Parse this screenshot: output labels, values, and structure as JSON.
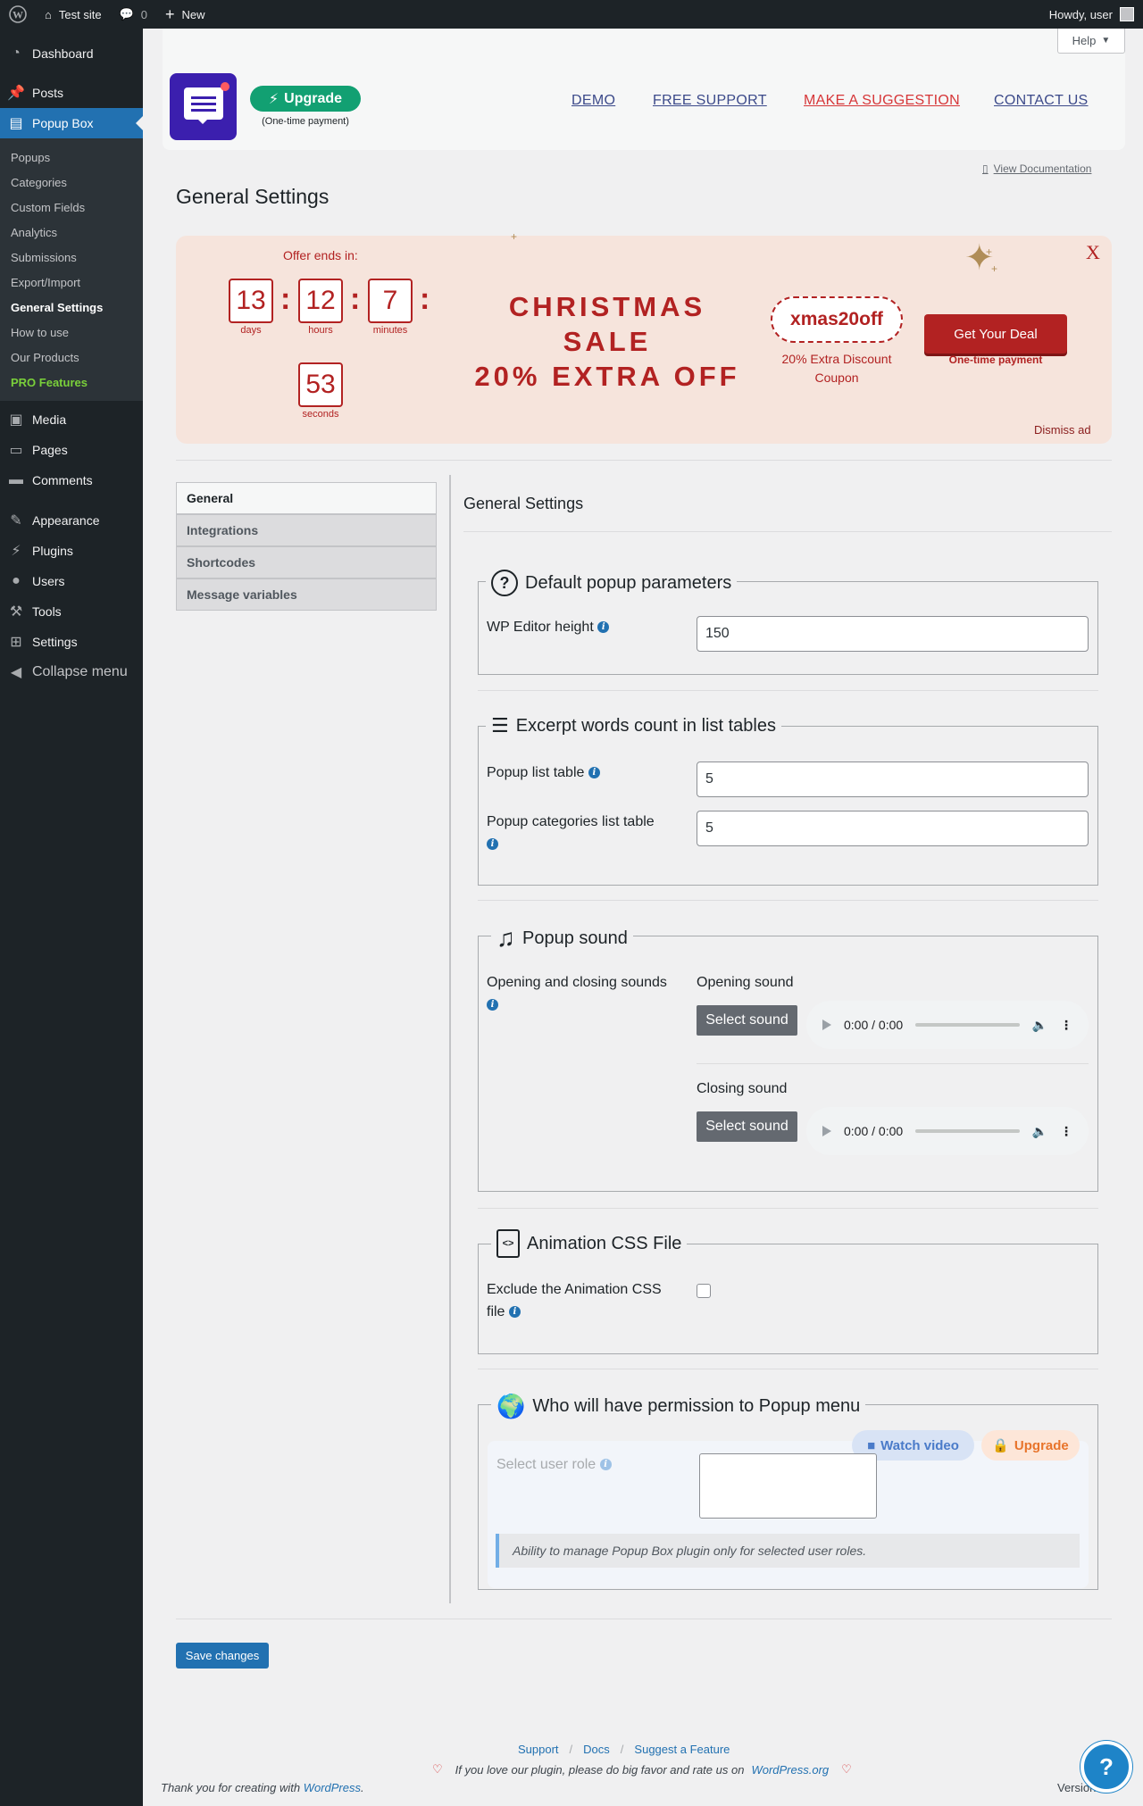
{
  "adminbar": {
    "site_name": "Test site",
    "comments_count": "0",
    "new_label": "New",
    "howdy": "Howdy, user"
  },
  "sidebar": {
    "top_items": [
      {
        "label": "Dashboard",
        "icon": "dashboard-icon"
      },
      {
        "label": "Posts",
        "icon": "pin-icon"
      },
      {
        "label": "Popup Box",
        "icon": "popup-icon"
      }
    ],
    "submenu": [
      "Popups",
      "Categories",
      "Custom Fields",
      "Analytics",
      "Submissions",
      "Export/Import",
      "General Settings",
      "How to use",
      "Our Products",
      "PRO Features"
    ],
    "bottom_items": [
      "Media",
      "Pages",
      "Comments",
      "Appearance",
      "Plugins",
      "Users",
      "Tools",
      "Settings",
      "Collapse menu"
    ]
  },
  "header": {
    "help_label": "Help",
    "upgrade_label": "Upgrade",
    "upgrade_sub": "(One-time payment)",
    "nav": [
      "DEMO",
      "FREE SUPPORT",
      "MAKE A SUGGESTION",
      "CONTACT US"
    ]
  },
  "view_documentation": "View Documentation",
  "page_title": "General Settings",
  "promo": {
    "offer_ends": "Offer ends in:",
    "countdown": {
      "days": "13",
      "days_label": "days",
      "hours": "12",
      "hours_label": "hours",
      "minutes": "7",
      "minutes_label": "minutes",
      "seconds": "53",
      "seconds_label": "seconds"
    },
    "title_line1": "CHRISTMAS",
    "title_line2": "SALE",
    "title_line3": "20% EXTRA OFF",
    "coupon_code": "xmas20off",
    "coupon_note": "20% Extra Discount Coupon",
    "deal_button": "Get Your Deal",
    "deal_note": "One-time payment",
    "close": "X",
    "dismiss": "Dismiss ad",
    "accent_color": "#b22222"
  },
  "tabs": [
    "General",
    "Integrations",
    "Shortcodes",
    "Message variables"
  ],
  "section_title": "General Settings",
  "default_popup": {
    "legend": "Default popup parameters",
    "wp_editor_label": "WP Editor height",
    "wp_editor_value": "150"
  },
  "excerpt": {
    "legend": "Excerpt words count in list tables",
    "popup_list_label": "Popup list table",
    "popup_list_value": "5",
    "categories_label": "Popup categories list table",
    "categories_value": "5"
  },
  "sound": {
    "legend": "Popup sound",
    "label": "Opening and closing sounds",
    "opening_label": "Opening sound",
    "closing_label": "Closing sound",
    "select_button": "Select sound",
    "time": "0:00 / 0:00"
  },
  "animation": {
    "legend": "Animation CSS File",
    "label": "Exclude the Animation CSS file"
  },
  "permission": {
    "legend": "Who will have permission to Popup menu",
    "watch_video": "Watch video",
    "upgrade": "Upgrade",
    "select_label": "Select user role",
    "notice": "Ability to manage Popup Box plugin only for selected user roles."
  },
  "save_button": "Save changes",
  "footer": {
    "links": [
      "Support",
      "Docs",
      "Suggest a Feature"
    ],
    "love_text": "If you love our plugin, please do big favor and rate us on",
    "wporg": "WordPress.org",
    "thanks_prefix": "Thank you for creating with",
    "wordpress": "WordPress",
    "thanks_suffix": ".",
    "version": "Version"
  }
}
